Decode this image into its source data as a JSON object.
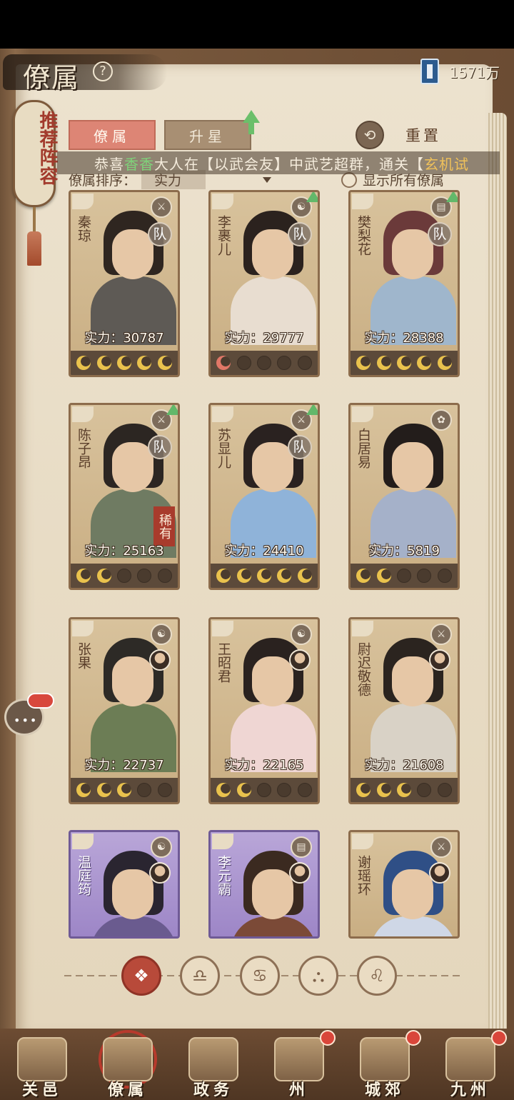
{
  "header": {
    "title": "僚属",
    "help_icon": "?",
    "currency_icon": "book-icon",
    "currency_value": "1571万"
  },
  "side_scroll": {
    "label": "推荐阵容"
  },
  "tabs": [
    {
      "label": "僚属",
      "active": true
    },
    {
      "label": "升星",
      "active": false
    }
  ],
  "reset": {
    "label": "重置",
    "icon": "reset-icon"
  },
  "marquee": {
    "prefix": "恭喜",
    "name": "香香",
    "middle": "大人在【以武会友】中武艺超群，通关【",
    "tail": "玄机试"
  },
  "sort": {
    "label": "僚属排序：",
    "value": "实力",
    "show_all_label": "显示所有僚属"
  },
  "power_prefix": "实力：",
  "cards": [
    {
      "name": "秦琼",
      "power": "30787",
      "team": "队",
      "rare": "",
      "stars": [
        "gold",
        "gold",
        "gold",
        "gold",
        "gold"
      ],
      "purple": false,
      "badge": "⚔",
      "hair": "#2f2620",
      "body": "#5e5a55",
      "upgrade": false,
      "mini_avatar": false
    },
    {
      "name": "李裹儿",
      "power": "29777",
      "team": "队",
      "rare": "",
      "stars": [
        "red",
        "empty",
        "empty",
        "empty",
        "empty"
      ],
      "purple": false,
      "badge": "☯",
      "hair": "#2b221e",
      "body": "#e8ddd0",
      "upgrade": true,
      "mini_avatar": false
    },
    {
      "name": "樊梨花",
      "power": "28388",
      "team": "队",
      "rare": "",
      "stars": [
        "gold",
        "gold",
        "gold",
        "gold",
        "gold"
      ],
      "purple": false,
      "badge": "▤",
      "hair": "#6b3a3a",
      "body": "#9fb6cc",
      "upgrade": true,
      "mini_avatar": false
    },
    {
      "name": "陈子昂",
      "power": "25163",
      "team": "队",
      "rare": "稀有",
      "stars": [
        "gold",
        "gold",
        "empty",
        "empty",
        "empty"
      ],
      "purple": false,
      "badge": "⚔",
      "hair": "#2c2622",
      "body": "#6f7b62",
      "upgrade": true,
      "mini_avatar": false
    },
    {
      "name": "苏显儿",
      "power": "24410",
      "team": "队",
      "rare": "",
      "stars": [
        "gold",
        "gold",
        "gold",
        "gold",
        "gold"
      ],
      "purple": false,
      "badge": "⚔",
      "hair": "#2a2220",
      "body": "#8fb3d9",
      "upgrade": true,
      "mini_avatar": false
    },
    {
      "name": "白居易",
      "power": "5819",
      "team": "",
      "rare": "",
      "stars": [
        "gold",
        "gold",
        "empty",
        "empty",
        "empty"
      ],
      "purple": false,
      "badge": "✿",
      "hair": "#231d1b",
      "body": "#a5b1c9",
      "upgrade": false,
      "mini_avatar": false
    },
    {
      "name": "张果",
      "power": "22737",
      "team": "",
      "rare": "",
      "stars": [
        "gold",
        "gold",
        "gold",
        "empty",
        "empty"
      ],
      "purple": false,
      "badge": "☯",
      "hair": "#2d2a26",
      "body": "#6c7d55",
      "upgrade": false,
      "mini_avatar": true
    },
    {
      "name": "王昭君",
      "power": "22165",
      "team": "",
      "rare": "",
      "stars": [
        "gold",
        "gold",
        "empty",
        "empty",
        "empty"
      ],
      "purple": false,
      "badge": "☯",
      "hair": "#2a221f",
      "body": "#efd6d3",
      "upgrade": false,
      "mini_avatar": true
    },
    {
      "name": "尉迟敬德",
      "power": "21608",
      "team": "",
      "rare": "",
      "stars": [
        "gold",
        "gold",
        "gold",
        "empty",
        "empty"
      ],
      "purple": false,
      "badge": "⚔",
      "hair": "#2b241f",
      "body": "#d9d2c6",
      "upgrade": false,
      "mini_avatar": true
    },
    {
      "name": "温庭筠",
      "power": "",
      "team": "",
      "rare": "",
      "stars": [],
      "purple": true,
      "badge": "☯",
      "hair": "#2a2530",
      "body": "#6a5b8f",
      "upgrade": false,
      "mini_avatar": true
    },
    {
      "name": "李元霸",
      "power": "",
      "team": "",
      "rare": "",
      "stars": [],
      "purple": true,
      "badge": "▤",
      "hair": "#3b2a20",
      "body": "#7b4a37",
      "upgrade": false,
      "mini_avatar": true
    },
    {
      "name": "谢瑶环",
      "power": "",
      "team": "",
      "rare": "",
      "stars": [],
      "purple": false,
      "badge": "⚔",
      "hair": "#2f4f86",
      "body": "#cfd7e6",
      "upgrade": false,
      "mini_avatar": true
    }
  ],
  "filters": [
    {
      "icon": "all-icon",
      "glyph": "❖",
      "active": true
    },
    {
      "icon": "bell-icon",
      "glyph": "♎",
      "active": false
    },
    {
      "icon": "gourd-icon",
      "glyph": "♋",
      "active": false
    },
    {
      "icon": "fan-icon",
      "glyph": "⛬",
      "active": false
    },
    {
      "icon": "lion-icon",
      "glyph": "♌",
      "active": false
    }
  ],
  "chat": {
    "icon": "chat-icon",
    "dots": "•••"
  },
  "bottom_nav": [
    {
      "label": "关邑",
      "icon": "city-gate-icon",
      "active": false,
      "dot": false
    },
    {
      "label": "僚属",
      "icon": "cards-icon",
      "active": true,
      "dot": false
    },
    {
      "label": "政务",
      "icon": "scroll-docs-icon",
      "active": false,
      "dot": false
    },
    {
      "label": "州",
      "icon": "mountain-map-icon",
      "active": false,
      "dot": true
    },
    {
      "label": "城郊",
      "icon": "village-icon",
      "active": false,
      "dot": true
    },
    {
      "label": "九州",
      "icon": "world-map-icon",
      "active": false,
      "dot": true
    }
  ]
}
